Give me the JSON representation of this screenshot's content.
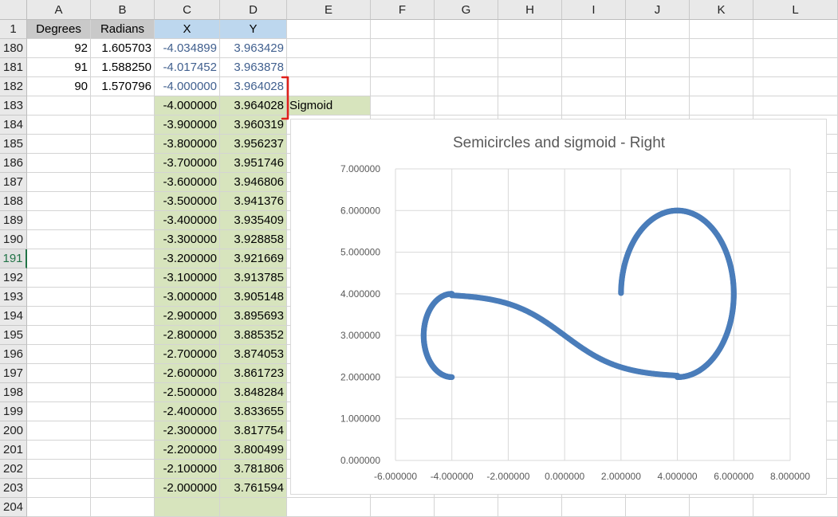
{
  "columns": [
    "A",
    "B",
    "C",
    "D",
    "E",
    "F",
    "G",
    "H",
    "I",
    "J",
    "K",
    "L"
  ],
  "header_row": {
    "num": "1",
    "A": "Degrees",
    "B": "Radians",
    "C": "X",
    "D": "Y"
  },
  "rows": [
    {
      "num": "180",
      "A": "92",
      "B": "1.605703",
      "C": "-4.034899",
      "D": "3.963429",
      "E": ""
    },
    {
      "num": "181",
      "A": "91",
      "B": "1.588250",
      "C": "-4.017452",
      "D": "3.963878",
      "E": ""
    },
    {
      "num": "182",
      "A": "90",
      "B": "1.570796",
      "C": "-4.000000",
      "D": "3.964028",
      "E": ""
    },
    {
      "num": "183",
      "A": "",
      "B": "",
      "C": "-4.000000",
      "D": "3.964028",
      "E": "Sigmoid"
    },
    {
      "num": "184",
      "A": "",
      "B": "",
      "C": "-3.900000",
      "D": "3.960319",
      "E": ""
    },
    {
      "num": "185",
      "A": "",
      "B": "",
      "C": "-3.800000",
      "D": "3.956237",
      "E": ""
    },
    {
      "num": "186",
      "A": "",
      "B": "",
      "C": "-3.700000",
      "D": "3.951746",
      "E": ""
    },
    {
      "num": "187",
      "A": "",
      "B": "",
      "C": "-3.600000",
      "D": "3.946806",
      "E": ""
    },
    {
      "num": "188",
      "A": "",
      "B": "",
      "C": "-3.500000",
      "D": "3.941376",
      "E": ""
    },
    {
      "num": "189",
      "A": "",
      "B": "",
      "C": "-3.400000",
      "D": "3.935409",
      "E": ""
    },
    {
      "num": "190",
      "A": "",
      "B": "",
      "C": "-3.300000",
      "D": "3.928858",
      "E": ""
    },
    {
      "num": "191",
      "A": "",
      "B": "",
      "C": "-3.200000",
      "D": "3.921669",
      "E": ""
    },
    {
      "num": "192",
      "A": "",
      "B": "",
      "C": "-3.100000",
      "D": "3.913785",
      "E": ""
    },
    {
      "num": "193",
      "A": "",
      "B": "",
      "C": "-3.000000",
      "D": "3.905148",
      "E": ""
    },
    {
      "num": "194",
      "A": "",
      "B": "",
      "C": "-2.900000",
      "D": "3.895693",
      "E": ""
    },
    {
      "num": "195",
      "A": "",
      "B": "",
      "C": "-2.800000",
      "D": "3.885352",
      "E": ""
    },
    {
      "num": "196",
      "A": "",
      "B": "",
      "C": "-2.700000",
      "D": "3.874053",
      "E": ""
    },
    {
      "num": "197",
      "A": "",
      "B": "",
      "C": "-2.600000",
      "D": "3.861723",
      "E": ""
    },
    {
      "num": "198",
      "A": "",
      "B": "",
      "C": "-2.500000",
      "D": "3.848284",
      "E": ""
    },
    {
      "num": "199",
      "A": "",
      "B": "",
      "C": "-2.400000",
      "D": "3.833655",
      "E": ""
    },
    {
      "num": "200",
      "A": "",
      "B": "",
      "C": "-2.300000",
      "D": "3.817754",
      "E": ""
    },
    {
      "num": "201",
      "A": "",
      "B": "",
      "C": "-2.200000",
      "D": "3.800499",
      "E": ""
    },
    {
      "num": "202",
      "A": "",
      "B": "",
      "C": "-2.100000",
      "D": "3.781806",
      "E": ""
    },
    {
      "num": "203",
      "A": "",
      "B": "",
      "C": "-2.000000",
      "D": "3.761594",
      "E": ""
    },
    {
      "num": "204",
      "A": "",
      "B": "",
      "C": "",
      "D": "",
      "E": ""
    }
  ],
  "selected_row": "191",
  "colors": {
    "header_gray": "#c9c9c9",
    "header_blue": "#bdd7ee",
    "green_fill": "#d7e4bd",
    "blue_text": "#41608f",
    "bracket_red": "#e0201b",
    "series": "#4a7dba",
    "selection_green": "#217346"
  },
  "chart_data": {
    "type": "scatter",
    "title": "Semicircles and sigmoid - Right",
    "xlim": [
      -6,
      8
    ],
    "ylim": [
      0,
      7
    ],
    "x_ticks": [
      "-6.000000",
      "-4.000000",
      "-2.000000",
      "0.000000",
      "2.000000",
      "4.000000",
      "6.000000",
      "8.000000"
    ],
    "y_ticks": [
      "0.000000",
      "1.000000",
      "2.000000",
      "3.000000",
      "4.000000",
      "5.000000",
      "6.000000",
      "7.000000"
    ],
    "grid": true,
    "series": [
      {
        "segments": [
          {
            "shape": "left semicircle",
            "center": [
              -4,
              3
            ],
            "radius": 1,
            "x": [
              -4.0,
              -4.5,
              -4.87,
              -5.0,
              -4.87,
              -4.5,
              -4.0
            ],
            "y": [
              2.0,
              2.13,
              2.5,
              3.0,
              3.5,
              3.87,
              4.0
            ]
          },
          {
            "shape": "sigmoid",
            "x": [
              -4,
              -3.5,
              -3,
              -2.5,
              -2,
              -1.5,
              -1,
              -0.5,
              0,
              0.5,
              1,
              1.5,
              2,
              2.5,
              3,
              3.5,
              4
            ],
            "y": [
              3.964,
              3.941,
              3.905,
              3.848,
              3.762,
              3.635,
              3.462,
              3.245,
              3.0,
              2.755,
              2.538,
              2.365,
              2.238,
              2.152,
              2.095,
              2.059,
              2.036
            ]
          },
          {
            "shape": "right semicircle",
            "center": [
              4,
              4
            ],
            "radius": 2,
            "x": [
              4.0,
              5.0,
              5.73,
              6.0,
              5.73,
              5.0,
              4.0,
              3.0,
              2.27,
              2.0
            ],
            "y": [
              2.0,
              2.27,
              3.0,
              4.0,
              5.0,
              5.73,
              6.0,
              5.73,
              5.0,
              4.0
            ]
          }
        ]
      }
    ]
  }
}
